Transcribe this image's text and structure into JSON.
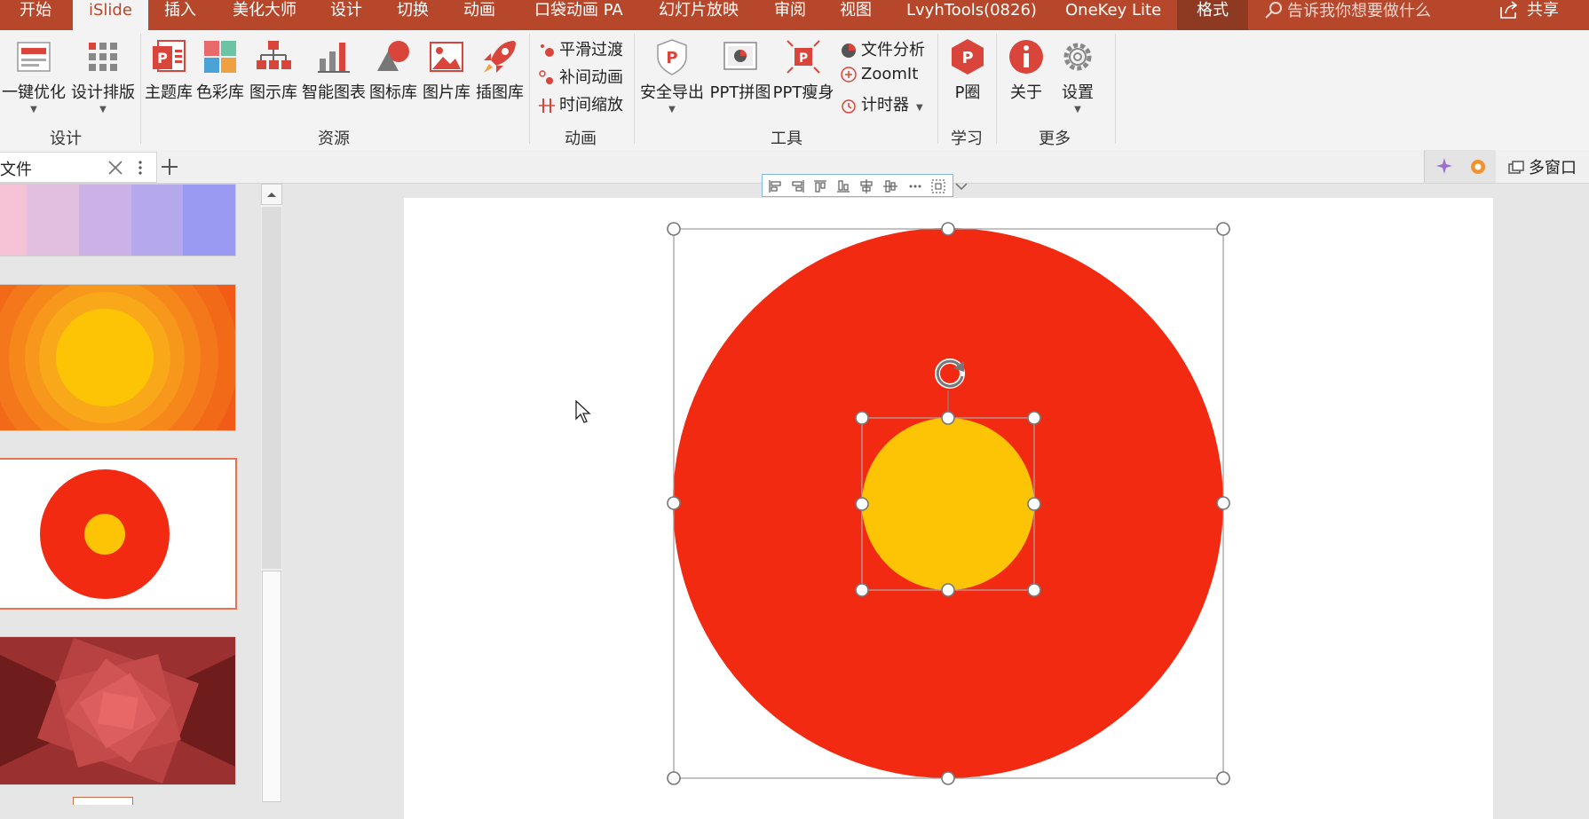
{
  "tabs": [
    "开始",
    "iSlide",
    "插入",
    "美化大师",
    "设计",
    "切换",
    "动画",
    "口袋动画 PA",
    "幻灯片放映",
    "审阅",
    "视图",
    "LvyhTools(0826)",
    "OneKey Lite",
    "格式"
  ],
  "tell_me": "告诉我你想要做什么",
  "share": "共享",
  "ribbon": {
    "design": {
      "group": "设计",
      "one_click": "一键优化",
      "layout": "设计排版"
    },
    "resources": {
      "group": "资源",
      "theme": "主题库",
      "color": "色彩库",
      "diagram": "图示库",
      "chart": "智能图表",
      "icon": "图标库",
      "picture": "图片库",
      "illustration": "插图库"
    },
    "animation": {
      "group": "动画",
      "smooth": "平滑过渡",
      "tween": "补间动画",
      "timescale": "时间缩放"
    },
    "tools": {
      "group": "工具",
      "safe_export": "安全导出",
      "ppt_stitch": "PPT拼图",
      "ppt_slim": "PPT瘦身",
      "file_analysis": "文件分析",
      "zoomit": "ZoomIt",
      "timer": "计时器"
    },
    "learn": {
      "group": "学习",
      "p_circle": "P圈"
    },
    "more": {
      "group": "更多",
      "about": "关于",
      "settings": "设置"
    }
  },
  "doc_tab": {
    "label": "文件"
  },
  "multiwindow": "多窗口",
  "colors": {
    "tabbar": "#b7472a",
    "red_circle": "#f22a12",
    "yellow_circle": "#fcc405"
  },
  "icons": [
    "search-icon",
    "share-icon",
    "close-icon",
    "more-icon",
    "plus-icon",
    "rotate-icon",
    "cursor-icon"
  ]
}
